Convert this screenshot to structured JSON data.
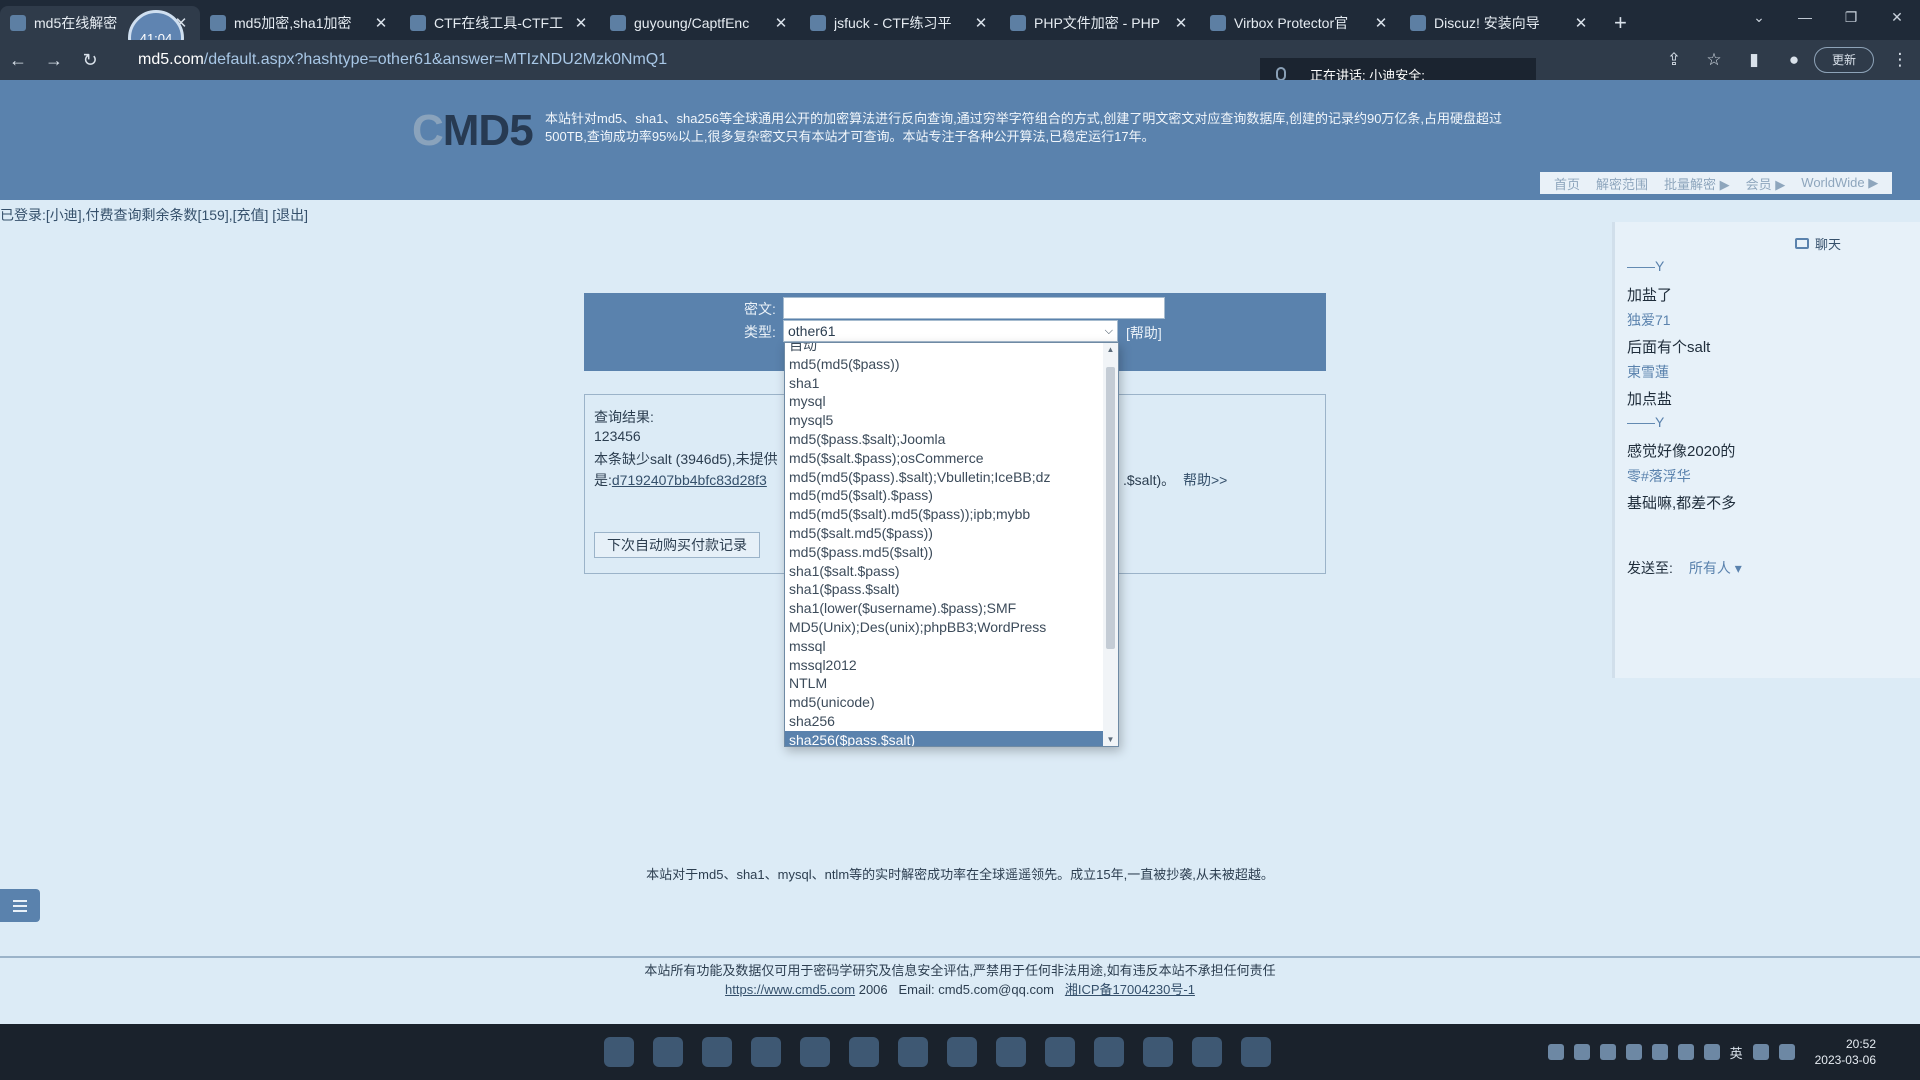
{
  "browser": {
    "tabs": [
      {
        "label": "md5在线解密",
        "active": true
      },
      {
        "label": "md5加密,sha1加密"
      },
      {
        "label": "CTF在线工具-CTF工"
      },
      {
        "label": "guyoung/CaptfEnc"
      },
      {
        "label": "jsfuck - CTF练习平"
      },
      {
        "label": "PHP文件加密 - PHP"
      },
      {
        "label": "Virbox Protector官"
      },
      {
        "label": "Discuz! 安装向导"
      }
    ],
    "url_host": "md5.com",
    "url_path": "/default.aspx?hashtype=other61&answer=MTIzNDU2Mzk0NmQ1",
    "update_label": "更新",
    "timer": "41:04",
    "speaking": "正在讲话: 小迪安全;"
  },
  "site": {
    "logo_c": "C",
    "logo_rest": "MD5",
    "intro": "本站针对md5、sha1、sha256等全球通用公开的加密算法进行反向查询,通过穷举字符组合的方式,创建了明文密文对应查询数据库,创建的记录约90万亿条,占用硬盘超过500TB,查询成功率95%以上,很多复杂密文只有本站才可查询。本站专注于各种公开算法,已稳定运行17年。",
    "nav": [
      "首页",
      "解密范围",
      "批量解密 ▶",
      "会员 ▶",
      "WorldWide ▶"
    ]
  },
  "login": {
    "prefix": "已登录:[",
    "user": "小迪",
    "middle": "],付费查询剩余条数[",
    "count": "159",
    "suffix": "],",
    "recharge": "[充值]",
    "logout": "[退出]"
  },
  "form": {
    "cipher_label": "密文:",
    "cipher_value": "",
    "type_label": "类型:",
    "type_value": "other61",
    "help": "[帮助]"
  },
  "dropdown": {
    "options": [
      "自动",
      "md5(md5($pass))",
      "sha1",
      "mysql",
      "mysql5",
      "md5($pass.$salt);Joomla",
      "md5($salt.$pass);osCommerce",
      "md5(md5($pass).$salt);Vbulletin;IceBB;dz",
      "md5(md5($salt).$pass)",
      "md5(md5($salt).md5($pass));ipb;mybb",
      "md5($salt.md5($pass))",
      "md5($pass.md5($salt))",
      "sha1($salt.$pass)",
      "sha1($pass.$salt)",
      "sha1(lower($username).$pass);SMF",
      "MD5(Unix);Des(unix);phpBB3;WordPress",
      "mssql",
      "mssql2012",
      "NTLM",
      "md5(unicode)",
      "sha256",
      "sha256($pass.$salt)"
    ],
    "selected": "sha256($pass.$salt)"
  },
  "result": {
    "heading": "查询结果:",
    "plain": "123456",
    "note": "本条缺少salt (3946d5),未提供",
    "hash_prefix": "是:",
    "hash": "d7192407bb4bfc83d28f3",
    "salt_tail": ".$salt)。",
    "help": "帮助>>",
    "buy_button": "下次自动购买付款记录"
  },
  "chat": {
    "title": "聊天",
    "messages": [
      {
        "name": "——Y",
        "text": "加盐了"
      },
      {
        "name": "独爱71",
        "text": "后面有个salt"
      },
      {
        "name": "東雪蓮",
        "text": "加点盐"
      },
      {
        "name": "——Y",
        "text": "感觉好像2020的"
      },
      {
        "name": "零#落浮华",
        "text": "基础嘛,都差不多"
      }
    ],
    "send_label": "发送至:",
    "send_to": "所有人 ▾"
  },
  "footer": {
    "note": "本站对于md5、sha1、mysql、ntlm等的实时解密成功率在全球遥遥领先。成立15年,一直被抄袭,从未被超越。",
    "disclaimer": "本站所有功能及数据仅可用于密码学研究及信息安全评估,严禁用于任何非法用途,如有违反本站不承担任何责任",
    "link": "https://www.cmd5.com",
    "year": "2006",
    "email": "Email: cmd5.com@qq.com",
    "icp": "湘ICP备17004230号-1"
  },
  "taskbar": {
    "lang": "英",
    "time": "20:52",
    "date": "2023-03-06"
  }
}
